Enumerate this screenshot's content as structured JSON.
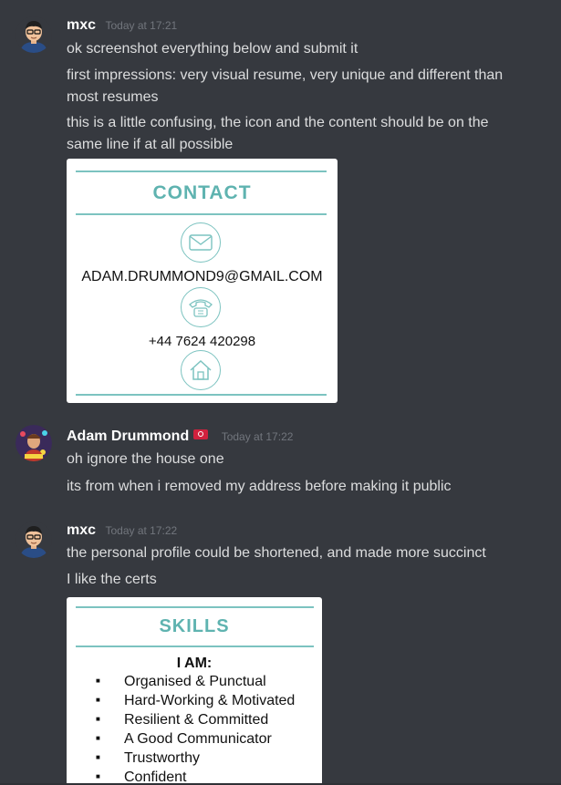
{
  "messages": [
    {
      "author": "mxc",
      "timestamp": "Today at 17:21",
      "lines": [
        "ok screenshot everything below and submit it",
        "first impressions: very visual resume, very unique and different than most resumes",
        "this is a little confusing, the icon and the content should be on the same line if at all possible"
      ]
    },
    {
      "author": "Adam Drummond",
      "timestamp": "Today at 17:22",
      "lines": [
        "oh ignore the house one",
        "its from when i removed my address before making it public"
      ]
    },
    {
      "author": "mxc",
      "timestamp": "Today at 17:22",
      "lines": [
        "the personal profile could be shortened, and made more succinct",
        "I like the certs"
      ]
    }
  ],
  "contact_attachment": {
    "title": "CONTACT",
    "email": "ADAM.DRUMMOND9@GMAIL.COM",
    "phone": "+44 7624 420298",
    "icons": [
      "mail-icon",
      "phone-icon",
      "home-icon"
    ]
  },
  "skills_attachment": {
    "title": "SKILLS",
    "subtitle": "I AM:",
    "items": [
      "Organised & Punctual",
      "Hard-Working & Motivated",
      "Resilient & Committed",
      "A Good Communicator",
      "Trustworthy",
      "Confident"
    ]
  },
  "colors": {
    "background": "#36393f",
    "accent_teal": "#7cc3c0",
    "text": "#dcddde",
    "timestamp": "#72767d"
  }
}
